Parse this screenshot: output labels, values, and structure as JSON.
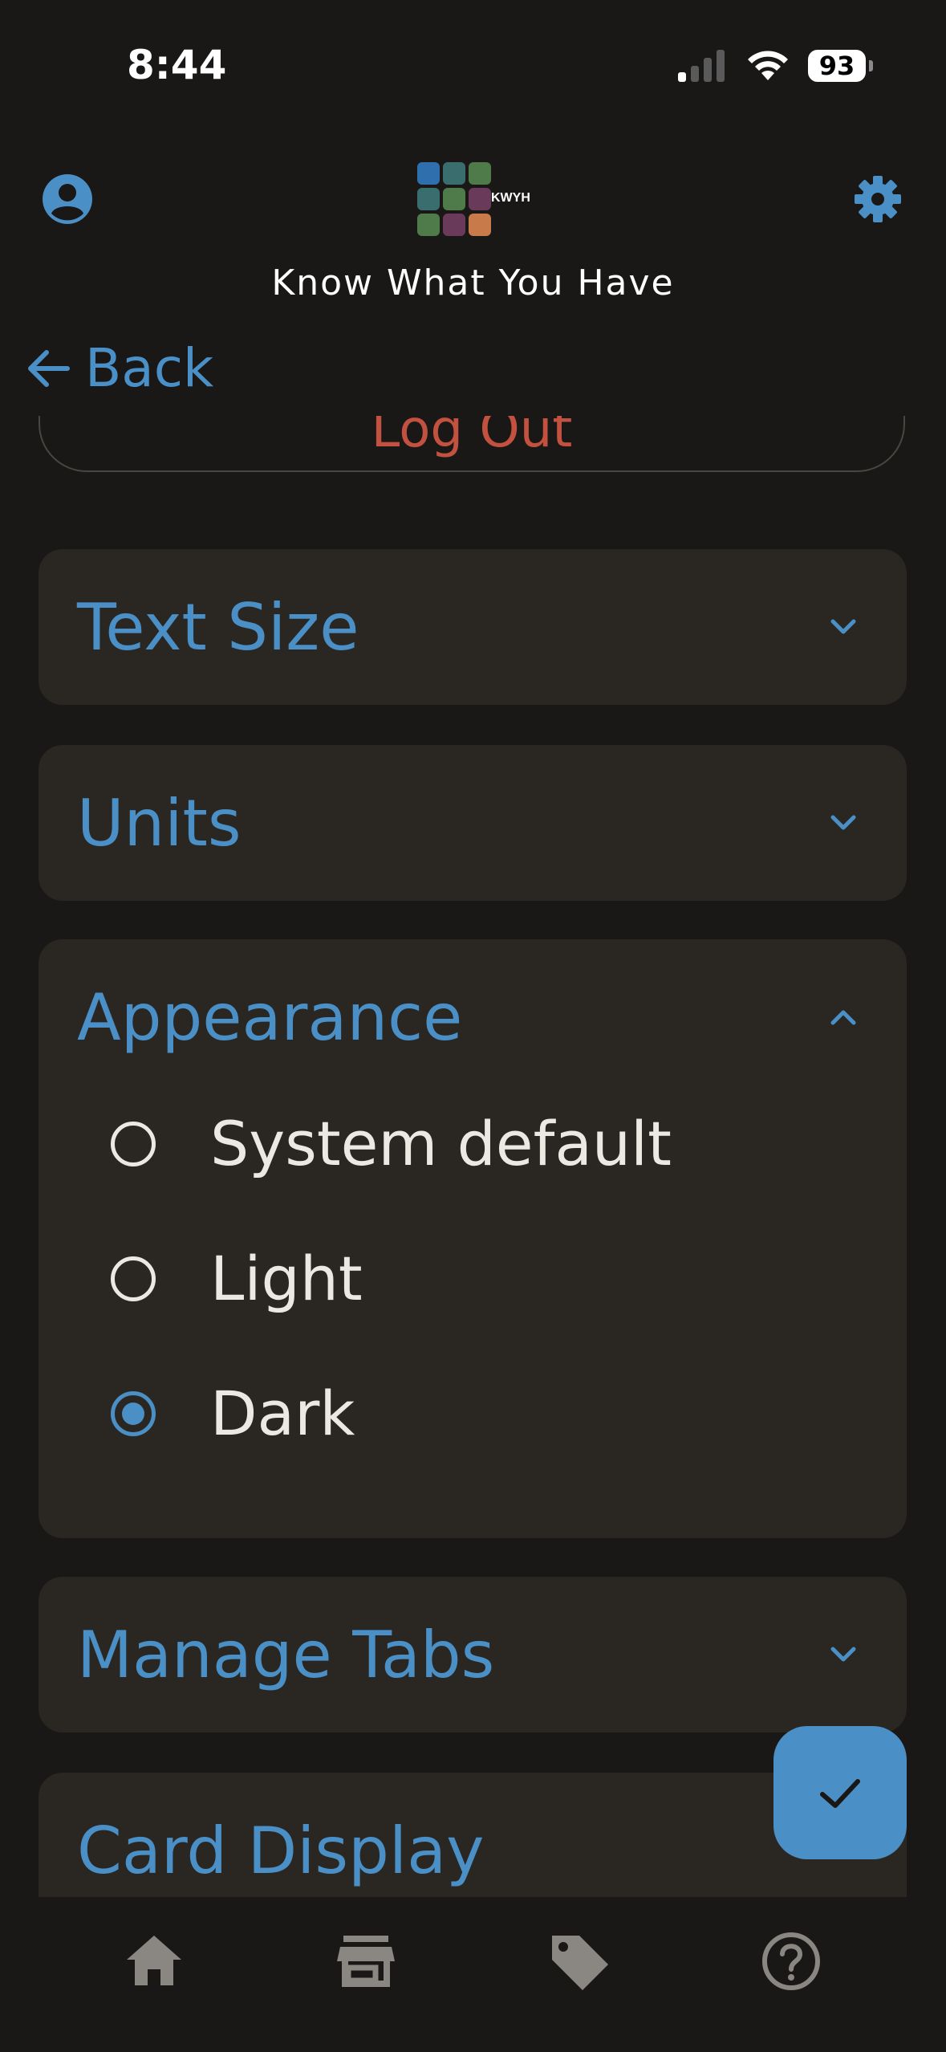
{
  "status_bar": {
    "time": "8:44",
    "battery": "93"
  },
  "header": {
    "title": "Know What You Have",
    "logo_text": "KWYH"
  },
  "nav": {
    "back_label": "Back"
  },
  "actions": {
    "logout_label": "Log Out"
  },
  "settings": {
    "sections": [
      {
        "title": "Text Size",
        "expanded": false
      },
      {
        "title": "Units",
        "expanded": false
      },
      {
        "title": "Appearance",
        "expanded": true
      },
      {
        "title": "Manage Tabs",
        "expanded": false
      },
      {
        "title": "Card Display",
        "expanded": false
      }
    ],
    "appearance_options": [
      {
        "label": "System default",
        "selected": false
      },
      {
        "label": "Light",
        "selected": false
      },
      {
        "label": "Dark",
        "selected": true
      }
    ]
  },
  "bottom_nav": [
    "home-icon",
    "store-icon",
    "tag-icon",
    "help-icon"
  ],
  "colors": {
    "accent": "#4a8fc6",
    "danger": "#c2513f",
    "background": "#1a1816",
    "panel": "#2a2723"
  }
}
